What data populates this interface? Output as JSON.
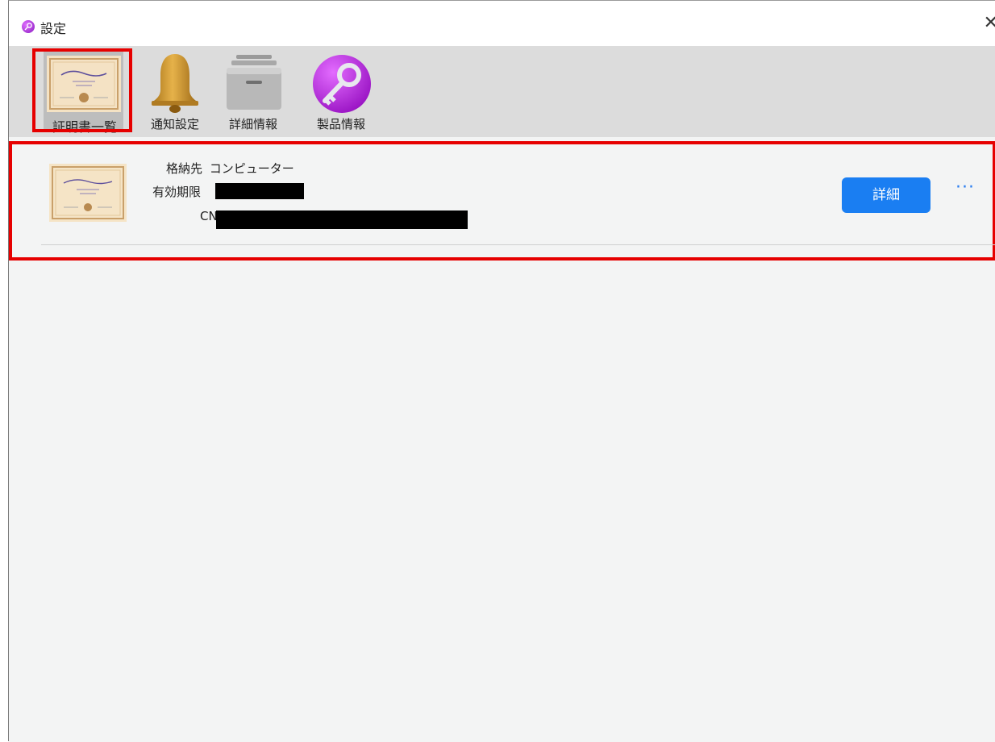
{
  "window": {
    "title": "設定",
    "close_glyph": "✕"
  },
  "toolbar": {
    "items": [
      {
        "label": "証明書一覧",
        "icon": "certificate-icon",
        "selected": true
      },
      {
        "label": "通知設定",
        "icon": "bell-icon",
        "selected": false
      },
      {
        "label": "詳細情報",
        "icon": "file-cabinet-icon",
        "selected": false
      },
      {
        "label": "製品情報",
        "icon": "key-icon",
        "selected": false
      }
    ]
  },
  "certificate": {
    "store_label": "格納先",
    "store_value": "コンピューター",
    "expiry_label": "有効期限",
    "cn_label": "CN",
    "detail_button": "詳細",
    "more_glyph": "···"
  },
  "colors": {
    "accent": "#1a7ef2",
    "highlight": "#e60000"
  }
}
